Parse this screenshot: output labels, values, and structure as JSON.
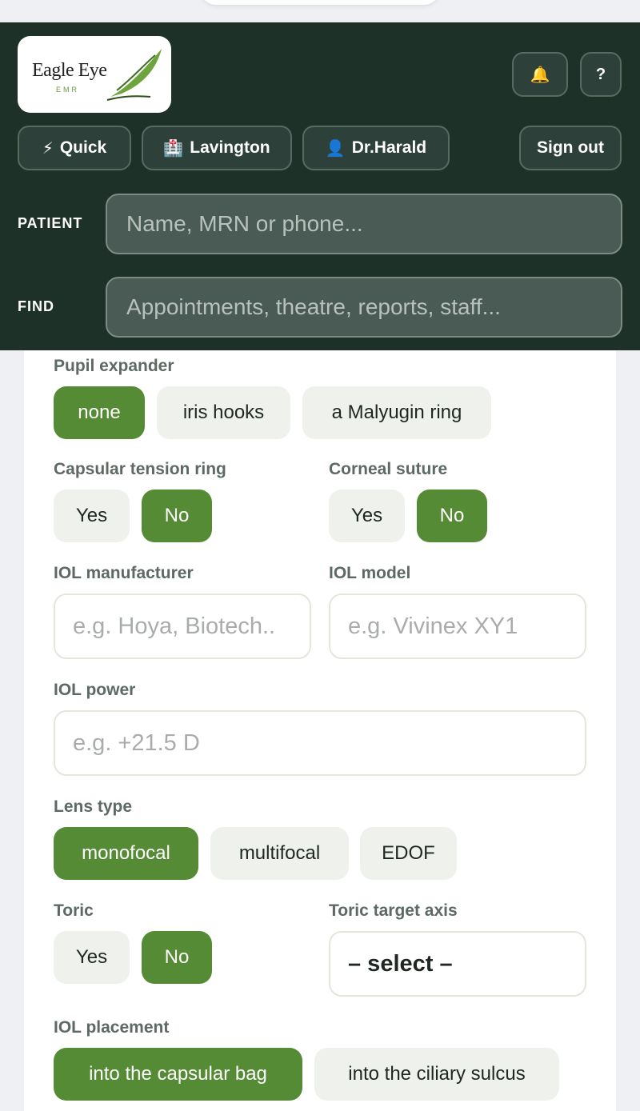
{
  "header": {
    "logo": {
      "name": "Eagle Eye",
      "sub": "EMR"
    },
    "notifications_icon": "bell-icon",
    "help_label": "?",
    "chips": [
      {
        "icon": "⚡",
        "label": "Quick"
      },
      {
        "icon": "🏥",
        "label": "Lavington"
      },
      {
        "icon": "👤",
        "label": "Dr.Harald"
      }
    ],
    "sign_out": "Sign out",
    "patient": {
      "label": "PATIENT",
      "placeholder": "Name, MRN or phone..."
    },
    "find": {
      "label": "FIND",
      "placeholder": "Appointments, theatre, reports, staff..."
    }
  },
  "form": {
    "pupil_expander": {
      "label": "Pupil expander",
      "options": [
        "none",
        "iris hooks",
        "a Malyugin ring"
      ],
      "selected": "none"
    },
    "capsular_tension_ring": {
      "label": "Capsular tension ring",
      "options": [
        "Yes",
        "No"
      ],
      "selected": "No"
    },
    "corneal_suture": {
      "label": "Corneal suture",
      "options": [
        "Yes",
        "No"
      ],
      "selected": "No"
    },
    "iol_manufacturer": {
      "label": "IOL manufacturer",
      "placeholder": "e.g. Hoya, Biotech..",
      "value": ""
    },
    "iol_model": {
      "label": "IOL model",
      "placeholder": "e.g. Vivinex XY1",
      "value": ""
    },
    "iol_power": {
      "label": "IOL power",
      "placeholder": "e.g. +21.5 D",
      "value": ""
    },
    "lens_type": {
      "label": "Lens type",
      "options": [
        "monofocal",
        "multifocal",
        "EDOF"
      ],
      "selected": "monofocal"
    },
    "toric": {
      "label": "Toric",
      "options": [
        "Yes",
        "No"
      ],
      "selected": "No"
    },
    "toric_target_axis": {
      "label": "Toric target axis",
      "value": "– select –"
    },
    "iol_placement": {
      "label": "IOL placement",
      "options": [
        "into the capsular bag",
        "into the ciliary sulcus"
      ],
      "selected": "into the capsular bag"
    }
  },
  "colors": {
    "header_bg": "#1e3129",
    "accent": "#558b34",
    "chip_bg": "#eef1ec"
  }
}
